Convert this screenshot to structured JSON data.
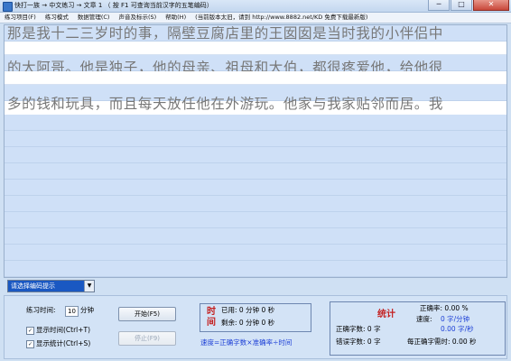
{
  "window": {
    "title": "快打一族 → 中文练习 → 文章 1 （ 按 F1 可查询当前汉字的五笔编码）",
    "controls": [
      "─",
      "□",
      "✕"
    ]
  },
  "menu": [
    "练习项目(F)",
    "练习模式",
    "数据管理(C)",
    "声音及标示(S)",
    "帮助(H)",
    "(当前版本太旧，请到 http://www.8882.net/KD 免费下载最新版)"
  ],
  "text_lines": [
    "那是我十二三岁时的事，隔壁豆腐店里的王囡囡是当时我的小伴侣中",
    "的大阿哥。他是独子，他的母亲、祖母和大伯，都很疼爱他，给他很",
    "多的钱和玩具，而且每天放任他在外游玩。他家与我家贴邻而居。我"
  ],
  "encoding": {
    "selected": "请选择编码提示"
  },
  "controls": {
    "practice_time_label": "练习时间:",
    "practice_time_value": "10",
    "practice_time_unit": "分钟",
    "show_time_label": "显示时间(Ctrl+T)",
    "show_time_checked": true,
    "show_stats_label": "显示统计(Ctrl+S)",
    "show_stats_checked": true,
    "start_label": "开始(F5)",
    "stop_label": "停止(F9)"
  },
  "time_panel": {
    "title": "时间",
    "used": "已用: 0 分钟 0 秒",
    "remaining": "剩余: 0 分钟 0 秒",
    "formula": "速度=正确字数×准确率÷时间"
  },
  "stats_panel": {
    "title": "统计",
    "correct_count": "正确字数: 0 字",
    "error_count": "错误字数: 0 字",
    "accuracy": "正确率: 0.00 %",
    "speed_label": "速度:",
    "speed_per_min": "0 字/分钟",
    "speed_per_sec": "0.00 字/秒",
    "time_per_char": "每正确字需时: 0.00 秒"
  },
  "colors": {
    "accent": "#1a58c2",
    "highlight_red": "#c41f1f",
    "text_blue": "#1c3fd6",
    "row_fill": "#cfe0f7"
  }
}
